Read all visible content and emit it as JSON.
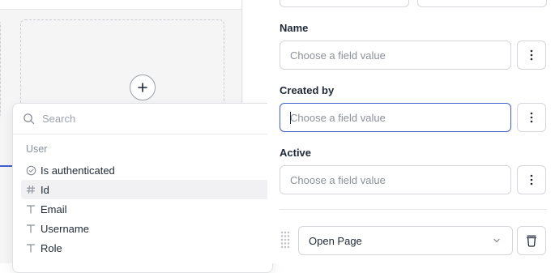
{
  "dropdown": {
    "search_placeholder": "Search",
    "group_label": "User",
    "items": [
      {
        "label": "Is authenticated",
        "icon": "check-circle-icon"
      },
      {
        "label": "Id",
        "icon": "hash-icon"
      },
      {
        "label": "Email",
        "icon": "text-type-icon"
      },
      {
        "label": "Username",
        "icon": "text-type-icon"
      },
      {
        "label": "Role",
        "icon": "text-type-icon"
      }
    ]
  },
  "fields": {
    "name": {
      "label": "Name",
      "placeholder": "Choose a field value"
    },
    "created_by": {
      "label": "Created by",
      "placeholder": "Choose a field value"
    },
    "active": {
      "label": "Active",
      "placeholder": "Choose a field value"
    }
  },
  "action": {
    "selected": "Open Page"
  },
  "colors": {
    "accent": "#3f5fd0",
    "border": "#d4d6db",
    "muted": "#8b9099"
  }
}
